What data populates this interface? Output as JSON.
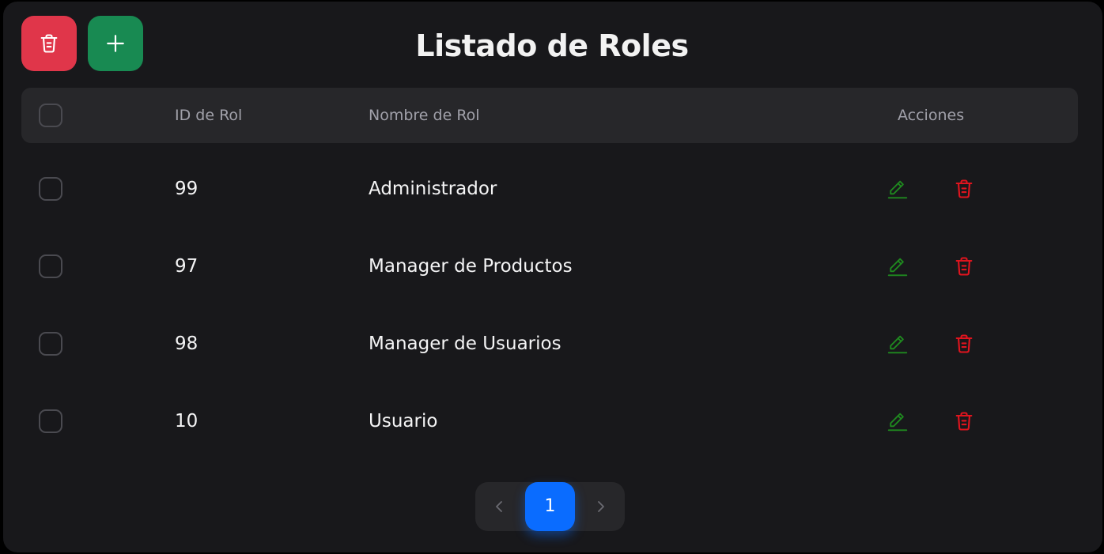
{
  "header": {
    "title": "Listado de Roles"
  },
  "toolbar": {
    "delete_selected_icon": "trash-icon",
    "add_icon": "plus-icon"
  },
  "table": {
    "columns": {
      "id": "ID de Rol",
      "name": "Nombre de Rol",
      "actions": "Acciones"
    },
    "rows": [
      {
        "id": "99",
        "name": "Administrador"
      },
      {
        "id": "97",
        "name": "Manager de Productos"
      },
      {
        "id": "98",
        "name": "Manager de Usuarios"
      },
      {
        "id": "10",
        "name": "Usuario"
      }
    ]
  },
  "pagination": {
    "current_page": "1"
  },
  "colors": {
    "background": "#18181b",
    "header_row": "#27272a",
    "delete_button": "#e0364a",
    "add_button": "#188a52",
    "edit_icon": "#1f8a1f",
    "delete_icon": "#e0141e",
    "active_page": "#0a6cff"
  }
}
